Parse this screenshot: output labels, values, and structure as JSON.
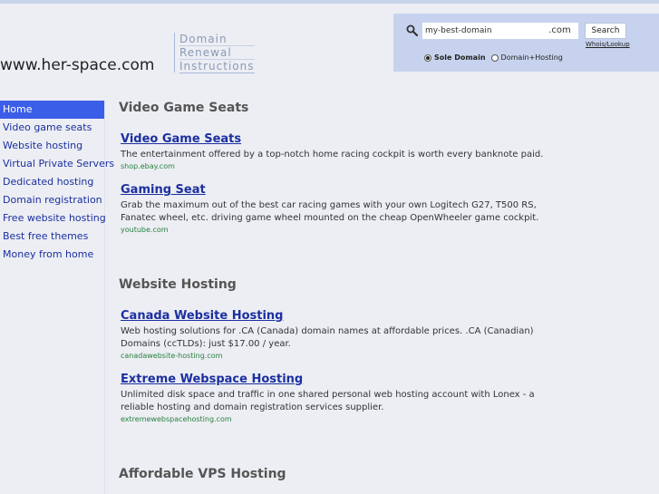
{
  "header": {
    "site_title": "www.her-space.com",
    "tagline": [
      "Domain",
      "Renewal",
      "Instructions"
    ]
  },
  "search": {
    "input_value": "my-best-domain",
    "tld": ".com",
    "button_label": "Search",
    "whois_label": "Whois/Lookup",
    "options": [
      "Sole Domain",
      "Domain+Hosting"
    ],
    "selected_option": "Sole Domain"
  },
  "sidebar": {
    "items": [
      {
        "label": "Home"
      },
      {
        "label": "Video game seats"
      },
      {
        "label": "Website hosting"
      },
      {
        "label": "Virtual Private Servers"
      },
      {
        "label": "Dedicated hosting"
      },
      {
        "label": "Domain registration"
      },
      {
        "label": "Free website hosting"
      },
      {
        "label": "Best free themes"
      },
      {
        "label": "Money from home"
      }
    ]
  },
  "sections": [
    {
      "title": "Video Game Seats",
      "ads": [
        {
          "title": "Video Game Seats",
          "desc": "The entertainment offered by a top-notch home racing cockpit is worth every banknote paid.",
          "url": "shop.ebay.com"
        },
        {
          "title": "Gaming Seat",
          "desc": "Grab the maximum out of the best car racing games with your own Logitech G27, T500 RS, Fanatec wheel, etc. driving game wheel mounted on the cheap OpenWheeler game cockpit.",
          "url": "youtube.com"
        }
      ]
    },
    {
      "title": "Website Hosting",
      "ads": [
        {
          "title": "Canada Website Hosting",
          "desc": "Web hosting solutions for .CA (Canada) domain names at affordable prices. .CA (Canadian) Domains (ccTLDs): just $17.00 / year.",
          "url": "canadawebsite-hosting.com"
        },
        {
          "title": "Extreme Webspace Hosting",
          "desc": "Unlimited disk space and traffic in one shared personal web hosting account with Lonex - a reliable hosting and domain registration services supplier.",
          "url": "extremewebspacehosting.com"
        }
      ]
    },
    {
      "title": "Affordable VPS Hosting",
      "ads": []
    }
  ]
}
